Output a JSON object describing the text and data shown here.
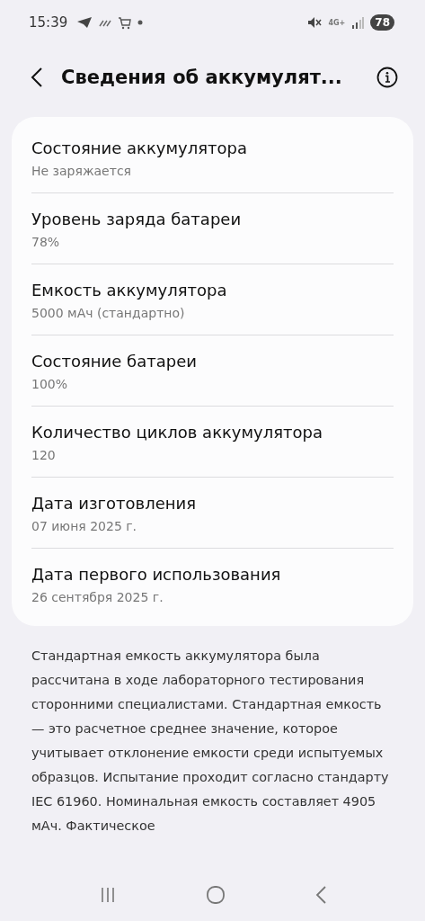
{
  "status_bar": {
    "time": "15:39",
    "network": "4G+",
    "battery": "78"
  },
  "header": {
    "title": "Сведения об аккумулят..."
  },
  "items": [
    {
      "title": "Состояние аккумулятора",
      "value": "Не заряжается"
    },
    {
      "title": "Уровень заряда батареи",
      "value": "78%"
    },
    {
      "title": "Емкость аккумулятора",
      "value": "5000 мАч (стандартно)"
    },
    {
      "title": "Состояние батареи",
      "value": "100%"
    },
    {
      "title": "Количество циклов аккумулятора",
      "value": "120"
    },
    {
      "title": "Дата изготовления",
      "value": "07 июня 2025 г."
    },
    {
      "title": "Дата первого использования",
      "value": "26 сентября 2025 г."
    }
  ],
  "note": "Стандартная емкость аккумулятора была рассчитана в ходе лабораторного тестирования сторонними специалистами. Стандартная емкость — это расчетное среднее значение, которое учитывает отклонение емкости среди испытуемых образцов. Испытание проходит согласно стандарту IEC 61960. Номинальная емкость составляет 4905 мАч. Фактическое"
}
